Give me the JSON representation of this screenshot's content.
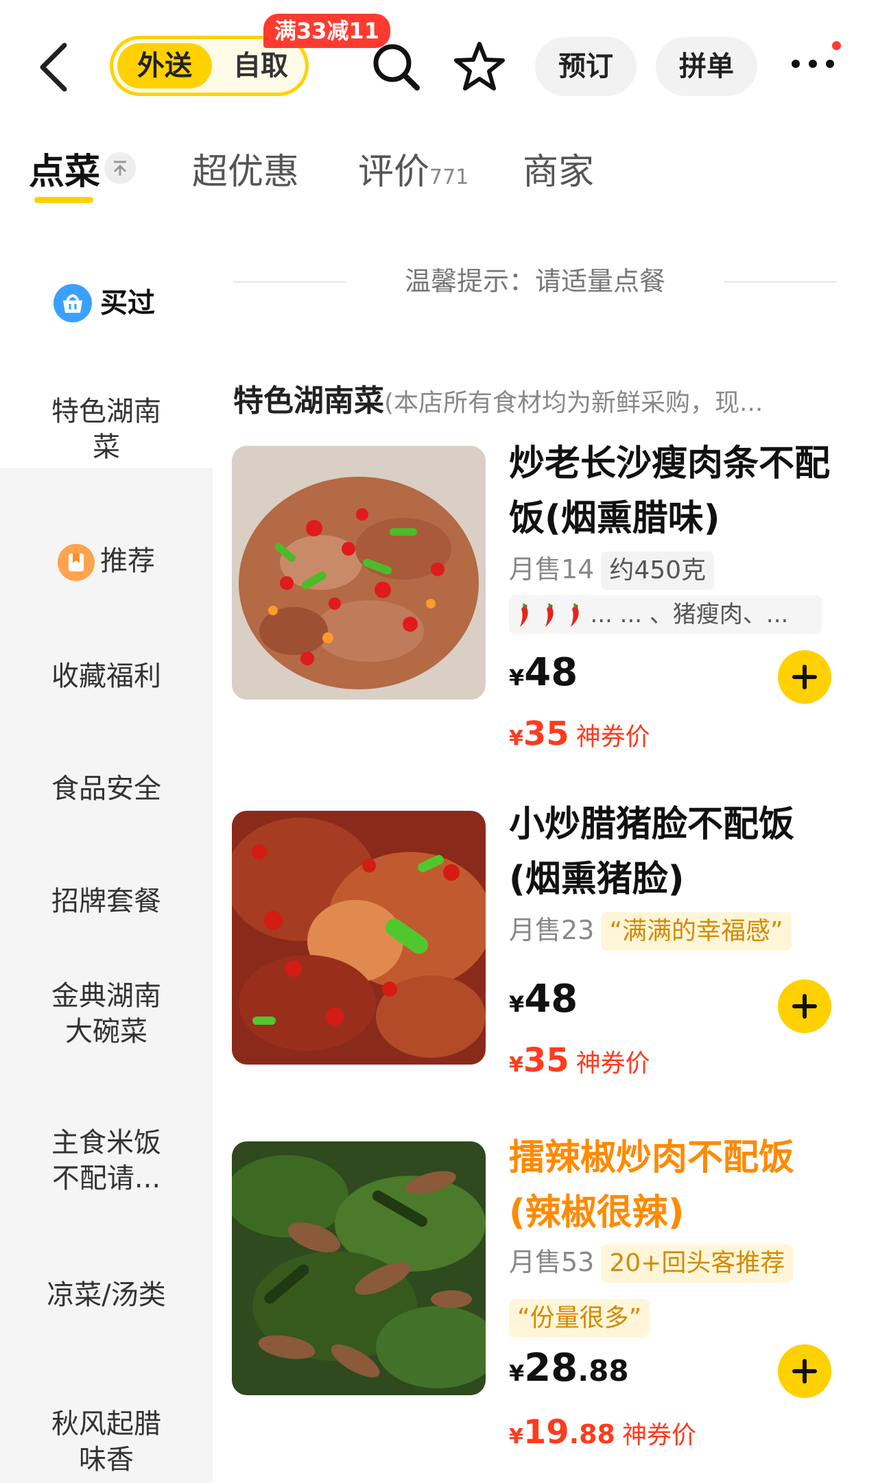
{
  "header": {
    "delivery_tab": "外送",
    "pickup_tab": "自取",
    "promo_badge": "满33减11",
    "reserve_button": "预订",
    "group_button": "拼单"
  },
  "tabs": [
    {
      "label": "点菜"
    },
    {
      "label": "超优惠"
    },
    {
      "label": "评价",
      "count": "771"
    },
    {
      "label": "商家"
    }
  ],
  "tip": "温馨提示：请适量点餐",
  "sidebar": {
    "bought_label": "买过",
    "items": [
      {
        "label": "特色湖南菜"
      },
      {
        "label": "推荐"
      },
      {
        "label": "收藏福利"
      },
      {
        "label": "食品安全"
      },
      {
        "label": "招牌套餐"
      },
      {
        "label": "金典湖南大碗菜"
      },
      {
        "label": "主食米饭不配请..."
      },
      {
        "label": "凉菜/汤类"
      },
      {
        "label": "秋风起腊味香"
      }
    ]
  },
  "category": {
    "title": "特色湖南菜",
    "note": "(本店所有食材均为新鲜采购，现..."
  },
  "dishes": [
    {
      "name": "炒老长沙瘦肉条不配饭(烟熏腊味)",
      "sold": "月售14",
      "badge": "约450克",
      "tags": "...  ...  、猪瘦肉、...",
      "currency": "¥",
      "price": "48",
      "coupon_price": "35",
      "coupon_label": "神券价"
    },
    {
      "name": "小炒腊猪脸不配饭(烟熏猪脸)",
      "sold": "月售23",
      "badge": "“满满的幸福感”",
      "currency": "¥",
      "price": "48",
      "coupon_price": "35",
      "coupon_label": "神券价"
    },
    {
      "name": "擂辣椒炒肉不配饭(辣椒很辣)",
      "sold": "月售53",
      "badge": "20+回头客推荐",
      "badge2": "“份量很多”",
      "currency": "¥",
      "price_int": "28",
      "price_dec": ".88",
      "coupon_int": "19",
      "coupon_dec": ".88",
      "coupon_label": "神券价"
    }
  ],
  "colors": {
    "brand_yellow": "#ffd100",
    "coupon_red": "#ff3b1f",
    "highlight_orange": "#ff8a00"
  }
}
